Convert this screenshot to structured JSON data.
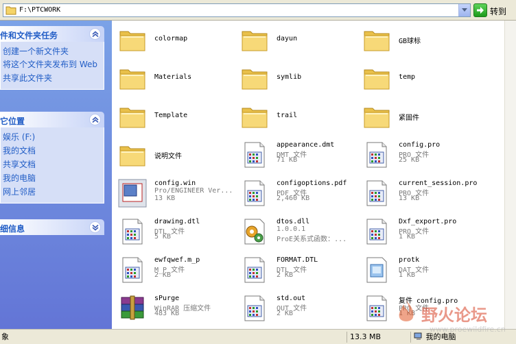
{
  "address": {
    "path": "F:\\PTCWORK",
    "go_label": "转到"
  },
  "taskpane": {
    "panels": [
      {
        "title": "件和文件夹任务",
        "links": [
          "创建一个新文件夹",
          "将这个文件夹发布到 Web",
          "共享此文件夹"
        ]
      },
      {
        "title": "它位置",
        "links": [
          "娱乐 (F:)",
          "我的文档",
          "共享文档",
          "我的电脑",
          "网上邻居"
        ]
      },
      {
        "title": "细信息",
        "links": []
      }
    ]
  },
  "items": [
    {
      "name": "colormap",
      "type": "folder"
    },
    {
      "name": "dayun",
      "type": "folder"
    },
    {
      "name": "GB球标",
      "type": "folder"
    },
    {
      "name": "Materials",
      "type": "folder"
    },
    {
      "name": "symlib",
      "type": "folder"
    },
    {
      "name": "temp",
      "type": "folder"
    },
    {
      "name": "Template",
      "type": "folder"
    },
    {
      "name": "trail",
      "type": "folder"
    },
    {
      "name": "紧固件",
      "type": "folder"
    },
    {
      "name": "说明文件",
      "type": "folder"
    },
    {
      "name": "appearance.dmt",
      "type": "doc",
      "line1": "DMT 文件",
      "line2": "71 KB"
    },
    {
      "name": "config.pro",
      "type": "doc",
      "line1": "PRO 文件",
      "line2": "25 KB"
    },
    {
      "name": "config.win",
      "type": "win",
      "line1": "Pro/ENGINEER Ver...",
      "line2": "13 KB"
    },
    {
      "name": "configoptions.pdf",
      "type": "doc",
      "line1": "PDF 文件",
      "line2": "2,460 KB"
    },
    {
      "name": "current_session.pro",
      "type": "doc",
      "line1": "PRO 文件",
      "line2": "13 KB"
    },
    {
      "name": "drawing.dtl",
      "type": "doc",
      "line1": "DTL 文件",
      "line2": "5 KB"
    },
    {
      "name": "dtos.dll",
      "type": "dll",
      "line1": "1.0.0.1",
      "line2": "ProE关系式函数：..."
    },
    {
      "name": "Dxf_export.pro",
      "type": "doc",
      "line1": "PRO 文件",
      "line2": "1 KB"
    },
    {
      "name": "ewfqwef.m_p",
      "type": "doc",
      "line1": "M_P 文件",
      "line2": "2 KB"
    },
    {
      "name": "FORMAT.DTL",
      "type": "doc",
      "line1": "DTL 文件",
      "line2": "2 KB"
    },
    {
      "name": "protk",
      "type": "dat",
      "line1": "DAT 文件",
      "line2": "1 KB"
    },
    {
      "name": "sPurge",
      "type": "rar",
      "line1": "WinRAR 压缩文件",
      "line2": "483 KB"
    },
    {
      "name": "std.out",
      "type": "doc",
      "line1": "OUT 文件",
      "line2": "2 KB"
    },
    {
      "name": "复件 config.pro",
      "type": "doc",
      "line1": "PRO 文件",
      "line2": "1 KB"
    }
  ],
  "status": {
    "left": "象",
    "size": "13.3 MB",
    "location": "我的电脑"
  },
  "watermark": {
    "text": "野火论坛",
    "sub": "www.proewildfire.cn"
  },
  "colors": {
    "taskpane_top": "#7ba2e7",
    "taskpane_bottom": "#6375d6",
    "link": "#215dc6",
    "folder": "#f5d468"
  }
}
